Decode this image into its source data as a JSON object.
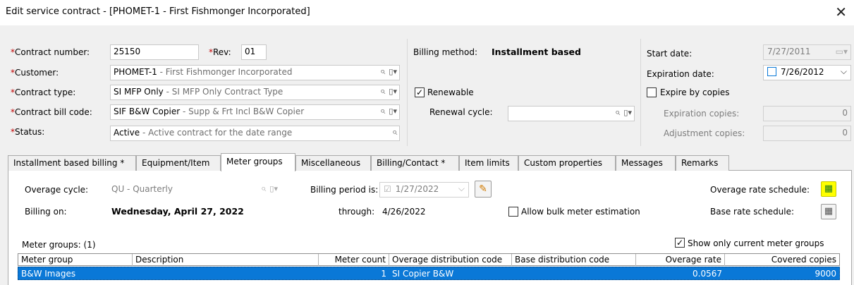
{
  "window": {
    "title": "Edit service contract - [PHOMET-1 - First Fishmonger Incorporated]",
    "close_symbol": "✕"
  },
  "header": {
    "contract_number": {
      "label": "Contract number:",
      "required_mark": "*",
      "value": "25150"
    },
    "rev": {
      "label": "Rev:",
      "required_mark": "*",
      "value": "01"
    },
    "customer": {
      "label": "Customer:",
      "required_mark": "*",
      "code": "PHOMET-1",
      "description": " - First Fishmonger Incorporated"
    },
    "contract_type": {
      "label": "Contract type:",
      "required_mark": "*",
      "code": "SI MFP Only",
      "description": " - SI MFP Only Contract Type"
    },
    "contract_bill_code": {
      "label": "Contract bill code:",
      "required_mark": "*",
      "code": "SIF B&W Copier",
      "description": " - Supp & Frt Incl B&W Copier"
    },
    "status": {
      "label": "Status:",
      "required_mark": "*",
      "code": "Active",
      "description": " - Active contract for the date range"
    },
    "billing_method": {
      "label": "Billing method:",
      "value": "Installment based"
    },
    "renewable": {
      "label": "Renewable",
      "checked": true
    },
    "renewal_cycle": {
      "label": "Renewal cycle:",
      "value": ""
    },
    "start_date": {
      "label": "Start date:",
      "value": "7/27/2011"
    },
    "expiration_date": {
      "label": "Expiration date:",
      "value": "7/26/2012"
    },
    "expire_by_copies": {
      "label": "Expire by copies",
      "checked": false
    },
    "expiration_copies": {
      "label": "Expiration copies:",
      "value": "0"
    },
    "adjustment_copies": {
      "label": "Adjustment copies:",
      "value": "0"
    }
  },
  "tabs": [
    {
      "label": "Installment based billing *"
    },
    {
      "label": "Equipment/Item"
    },
    {
      "label": "Meter groups",
      "active": true
    },
    {
      "label": "Miscellaneous"
    },
    {
      "label": "Billing/Contact *"
    },
    {
      "label": "Item limits"
    },
    {
      "label": "Custom properties"
    },
    {
      "label": "Messages"
    },
    {
      "label": "Remarks"
    }
  ],
  "meter_groups_tab": {
    "overage_cycle": {
      "label": "Overage cycle:",
      "value": "QU - Quarterly"
    },
    "billing_on": {
      "label": "Billing on:",
      "value": "Wednesday, April 27, 2022"
    },
    "billing_period": {
      "label": "Billing period is:",
      "value": "1/27/2022"
    },
    "through": {
      "label": "through:",
      "value": "4/26/2022"
    },
    "allow_bulk": {
      "label": "Allow bulk meter estimation",
      "checked": false
    },
    "overage_rate_schedule": {
      "label": "Overage rate schedule:"
    },
    "base_rate_schedule": {
      "label": "Base rate schedule:"
    },
    "meter_groups_count": "Meter groups: (1)",
    "show_only_current": {
      "label": "Show only current meter groups",
      "checked": true
    },
    "columns": [
      "Meter group",
      "Description",
      "Meter count",
      "Overage distribution code",
      "Base distribution code",
      "Overage rate",
      "Covered copies"
    ],
    "rows": [
      [
        "B&W Images",
        "",
        "1",
        "SI Copier B&W",
        "",
        "0.0567",
        "9000"
      ]
    ]
  },
  "colors": {
    "selection": "#0a78d7",
    "required": "#c00000",
    "highlight": "#ffff00"
  },
  "icons": [
    "search-icon",
    "picker-icon",
    "calendar-icon",
    "pencil-icon",
    "close-icon",
    "checkbox-icon"
  ]
}
